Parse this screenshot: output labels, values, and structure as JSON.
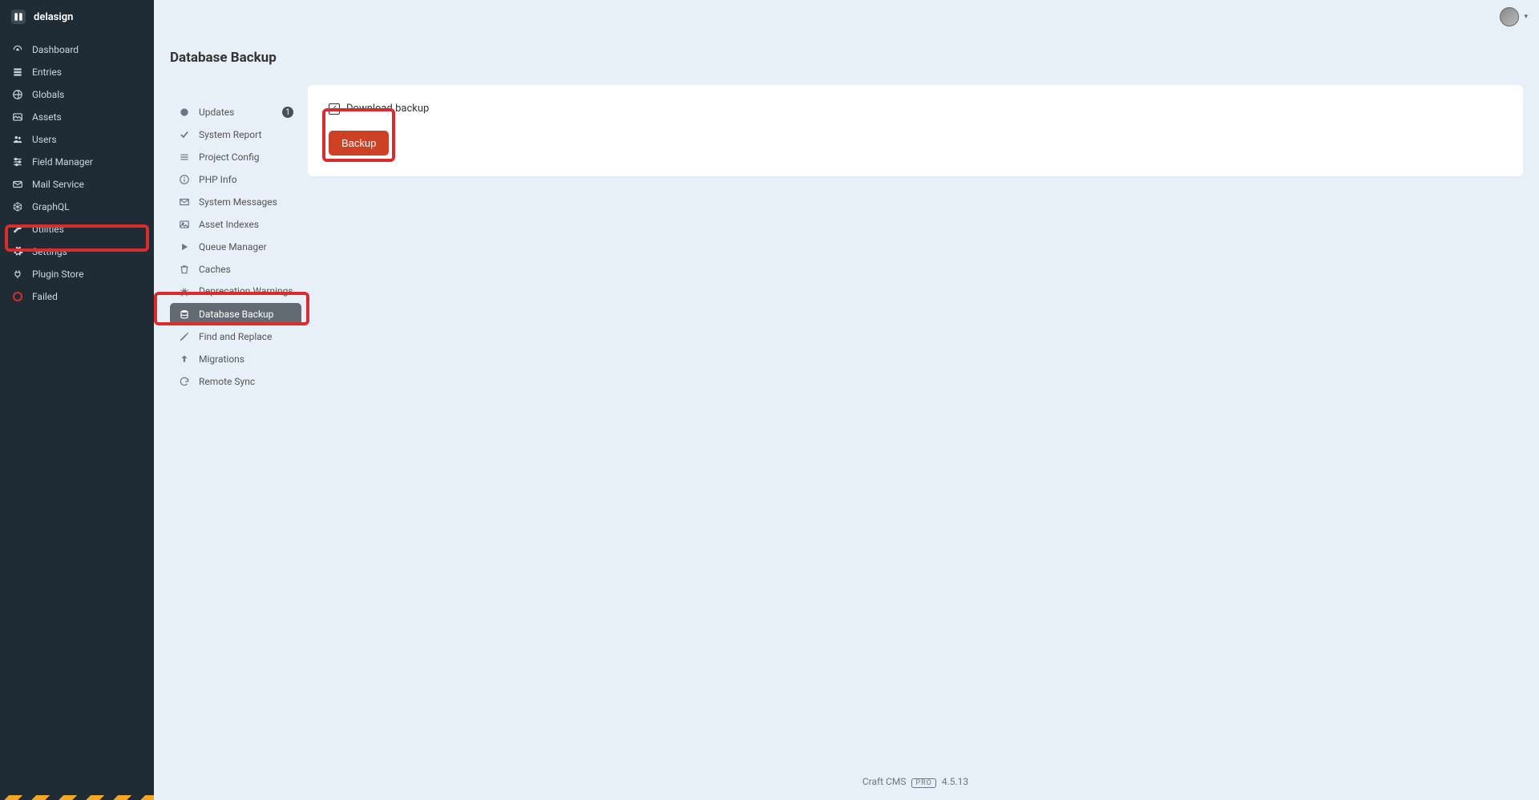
{
  "brand": "delasign",
  "page_title": "Database Backup",
  "sidebar": {
    "items": [
      {
        "label": "Dashboard",
        "icon": "gauge-icon"
      },
      {
        "label": "Entries",
        "icon": "document-icon"
      },
      {
        "label": "Globals",
        "icon": "globe-icon"
      },
      {
        "label": "Assets",
        "icon": "image-icon"
      },
      {
        "label": "Users",
        "icon": "users-icon"
      },
      {
        "label": "Field Manager",
        "icon": "sliders-icon"
      },
      {
        "label": "Mail Service",
        "icon": "mail-icon"
      },
      {
        "label": "GraphQL",
        "icon": "graphql-icon"
      },
      {
        "label": "Utilities",
        "icon": "wrench-icon"
      },
      {
        "label": "Settings",
        "icon": "gear-icon"
      },
      {
        "label": "Plugin Store",
        "icon": "plug-icon"
      },
      {
        "label": "Failed",
        "icon": "red-ring-icon"
      }
    ],
    "active_index": 8
  },
  "subnav": {
    "items": [
      {
        "label": "Updates",
        "icon": "refresh-icon",
        "badge": "1"
      },
      {
        "label": "System Report",
        "icon": "check-icon"
      },
      {
        "label": "Project Config",
        "icon": "config-icon"
      },
      {
        "label": "PHP Info",
        "icon": "info-icon"
      },
      {
        "label": "System Messages",
        "icon": "envelope-icon"
      },
      {
        "label": "Asset Indexes",
        "icon": "image-icon"
      },
      {
        "label": "Queue Manager",
        "icon": "play-icon"
      },
      {
        "label": "Caches",
        "icon": "trash-icon"
      },
      {
        "label": "Deprecation Warnings",
        "icon": "bug-icon"
      },
      {
        "label": "Database Backup",
        "icon": "database-icon"
      },
      {
        "label": "Find and Replace",
        "icon": "pencil-icon"
      },
      {
        "label": "Migrations",
        "icon": "arrow-up-icon"
      },
      {
        "label": "Remote Sync",
        "icon": "sync-icon"
      }
    ],
    "active_index": 9
  },
  "main": {
    "download_label": "Download backup",
    "download_checked": true,
    "backup_button": "Backup"
  },
  "footer": {
    "product": "Craft CMS",
    "edition": "PRO",
    "version": "4.5.13"
  }
}
